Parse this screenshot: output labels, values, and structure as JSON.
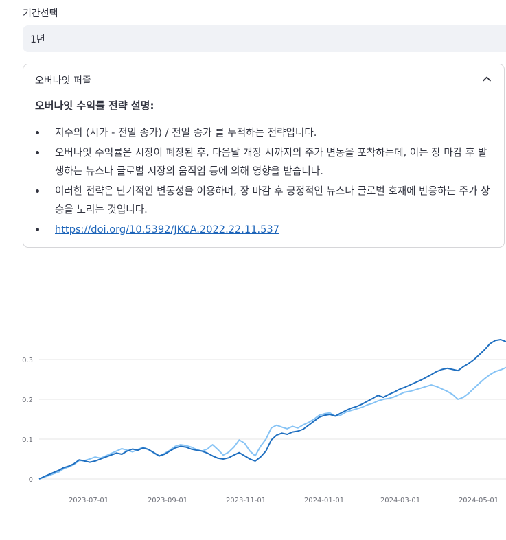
{
  "period": {
    "label": "기간선택",
    "selected": "1년"
  },
  "expander": {
    "header": "오버나잇 퍼즐",
    "title": "오버나잇 수익률 전략 설명:",
    "bullets": [
      "지수의 (시가 - 전일 종가) / 전일 종가 를 누적하는 전략입니다.",
      "오버나잇 수익률은 시장이 폐장된 후, 다음날 개장 시까지의 주가 변동을 포착하는데, 이는 장 마감 후 발생하는 뉴스나 글로벌 시장의 움직임 등에 의해 영향을 받습니다.",
      "이러한 전략은 단기적인 변동성을 이용하며, 장 마감 후 긍정적인 뉴스나 글로벌 호재에 반응하는 주가 상승을 노리는 것입니다."
    ],
    "link": "https://doi.org/10.5392/JKCA.2022.22.11.537",
    "chevron_icon": "chevron-up-icon"
  },
  "colors": {
    "series_dark": "#1f6fc0",
    "series_light": "#86c3f5",
    "grid": "#e6e6e6",
    "link": "#1c64b9"
  },
  "chart_data": {
    "type": "line",
    "x_start": "2023-05-19",
    "x_end": "2024-05-24",
    "x_tick_labels": [
      "2023-07-01",
      "2023-09-01",
      "2023-11-01",
      "2024-01-01",
      "2024-03-01",
      "2024-05-01"
    ],
    "y_tick_labels": [
      "0",
      "0.1",
      "0.2",
      "0.3"
    ],
    "ylim": [
      0,
      0.36
    ],
    "grid": true,
    "series": [
      {
        "color": "#1f6fc0",
        "values": [
          [
            0.0,
            0.0
          ],
          [
            2.5,
            0.008
          ],
          [
            5,
            0.015
          ],
          [
            7.5,
            0.022
          ],
          [
            9,
            0.028
          ],
          [
            11,
            0.032
          ],
          [
            13,
            0.038
          ],
          [
            15,
            0.048
          ],
          [
            17,
            0.045
          ],
          [
            19,
            0.042
          ],
          [
            21,
            0.045
          ],
          [
            23,
            0.05
          ],
          [
            25,
            0.055
          ],
          [
            27,
            0.06
          ],
          [
            29,
            0.065
          ],
          [
            31,
            0.062
          ],
          [
            33,
            0.07
          ],
          [
            35,
            0.075
          ],
          [
            37,
            0.072
          ],
          [
            39,
            0.078
          ],
          [
            41,
            0.074
          ],
          [
            43,
            0.066
          ],
          [
            45,
            0.058
          ],
          [
            47,
            0.062
          ],
          [
            49,
            0.07
          ],
          [
            51,
            0.078
          ],
          [
            53,
            0.082
          ],
          [
            55,
            0.08
          ],
          [
            57,
            0.075
          ],
          [
            59,
            0.072
          ],
          [
            61,
            0.07
          ],
          [
            63,
            0.065
          ],
          [
            65,
            0.058
          ],
          [
            67,
            0.052
          ],
          [
            69,
            0.05
          ],
          [
            71,
            0.053
          ],
          [
            73,
            0.06
          ],
          [
            75,
            0.066
          ],
          [
            77,
            0.058
          ],
          [
            79,
            0.05
          ],
          [
            81,
            0.045
          ],
          [
            83,
            0.055
          ],
          [
            85,
            0.07
          ],
          [
            87,
            0.098
          ],
          [
            89,
            0.11
          ],
          [
            91,
            0.115
          ],
          [
            93,
            0.112
          ],
          [
            95,
            0.118
          ],
          [
            97,
            0.12
          ],
          [
            99,
            0.125
          ],
          [
            101,
            0.135
          ],
          [
            103,
            0.145
          ],
          [
            105,
            0.155
          ],
          [
            107,
            0.16
          ],
          [
            109,
            0.162
          ],
          [
            111,
            0.158
          ],
          [
            113,
            0.165
          ],
          [
            115,
            0.172
          ],
          [
            117,
            0.178
          ],
          [
            119,
            0.182
          ],
          [
            121,
            0.188
          ],
          [
            123,
            0.195
          ],
          [
            125,
            0.202
          ],
          [
            127,
            0.21
          ],
          [
            129,
            0.205
          ],
          [
            131,
            0.212
          ],
          [
            133,
            0.218
          ],
          [
            135,
            0.225
          ],
          [
            137,
            0.23
          ],
          [
            139,
            0.236
          ],
          [
            141,
            0.242
          ],
          [
            143,
            0.248
          ],
          [
            145,
            0.255
          ],
          [
            147,
            0.262
          ],
          [
            149,
            0.27
          ],
          [
            151,
            0.275
          ],
          [
            153,
            0.278
          ],
          [
            155,
            0.275
          ],
          [
            157,
            0.272
          ],
          [
            159,
            0.282
          ],
          [
            161,
            0.29
          ],
          [
            163,
            0.3
          ],
          [
            165,
            0.312
          ],
          [
            167,
            0.325
          ],
          [
            169,
            0.34
          ],
          [
            171,
            0.348
          ],
          [
            173,
            0.35
          ],
          [
            175,
            0.345
          ]
        ]
      },
      {
        "color": "#86c3f5",
        "values": [
          [
            0.0,
            0.0
          ],
          [
            2.5,
            0.006
          ],
          [
            5,
            0.012
          ],
          [
            7.5,
            0.018
          ],
          [
            9,
            0.025
          ],
          [
            11,
            0.03
          ],
          [
            13,
            0.036
          ],
          [
            15,
            0.046
          ],
          [
            17,
            0.046
          ],
          [
            19,
            0.05
          ],
          [
            21,
            0.055
          ],
          [
            23,
            0.052
          ],
          [
            25,
            0.058
          ],
          [
            27,
            0.064
          ],
          [
            29,
            0.07
          ],
          [
            31,
            0.076
          ],
          [
            33,
            0.072
          ],
          [
            35,
            0.068
          ],
          [
            37,
            0.074
          ],
          [
            39,
            0.08
          ],
          [
            41,
            0.074
          ],
          [
            43,
            0.065
          ],
          [
            45,
            0.057
          ],
          [
            47,
            0.064
          ],
          [
            49,
            0.072
          ],
          [
            51,
            0.082
          ],
          [
            53,
            0.086
          ],
          [
            55,
            0.084
          ],
          [
            57,
            0.08
          ],
          [
            59,
            0.074
          ],
          [
            61,
            0.07
          ],
          [
            63,
            0.075
          ],
          [
            65,
            0.086
          ],
          [
            67,
            0.074
          ],
          [
            69,
            0.06
          ],
          [
            71,
            0.067
          ],
          [
            73,
            0.08
          ],
          [
            75,
            0.098
          ],
          [
            77,
            0.09
          ],
          [
            79,
            0.07
          ],
          [
            81,
            0.058
          ],
          [
            83,
            0.082
          ],
          [
            85,
            0.1
          ],
          [
            87,
            0.128
          ],
          [
            89,
            0.135
          ],
          [
            91,
            0.13
          ],
          [
            93,
            0.126
          ],
          [
            95,
            0.132
          ],
          [
            97,
            0.128
          ],
          [
            99,
            0.136
          ],
          [
            101,
            0.142
          ],
          [
            103,
            0.15
          ],
          [
            105,
            0.16
          ],
          [
            107,
            0.164
          ],
          [
            109,
            0.166
          ],
          [
            111,
            0.158
          ],
          [
            113,
            0.16
          ],
          [
            115,
            0.168
          ],
          [
            117,
            0.172
          ],
          [
            119,
            0.176
          ],
          [
            121,
            0.18
          ],
          [
            123,
            0.186
          ],
          [
            125,
            0.19
          ],
          [
            127,
            0.196
          ],
          [
            129,
            0.2
          ],
          [
            131,
            0.202
          ],
          [
            133,
            0.206
          ],
          [
            135,
            0.212
          ],
          [
            137,
            0.218
          ],
          [
            139,
            0.22
          ],
          [
            141,
            0.224
          ],
          [
            143,
            0.228
          ],
          [
            145,
            0.232
          ],
          [
            147,
            0.236
          ],
          [
            149,
            0.232
          ],
          [
            151,
            0.226
          ],
          [
            153,
            0.22
          ],
          [
            155,
            0.212
          ],
          [
            157,
            0.2
          ],
          [
            159,
            0.205
          ],
          [
            161,
            0.215
          ],
          [
            163,
            0.228
          ],
          [
            165,
            0.24
          ],
          [
            167,
            0.252
          ],
          [
            169,
            0.262
          ],
          [
            171,
            0.27
          ],
          [
            173,
            0.274
          ],
          [
            175,
            0.28
          ]
        ]
      }
    ]
  }
}
